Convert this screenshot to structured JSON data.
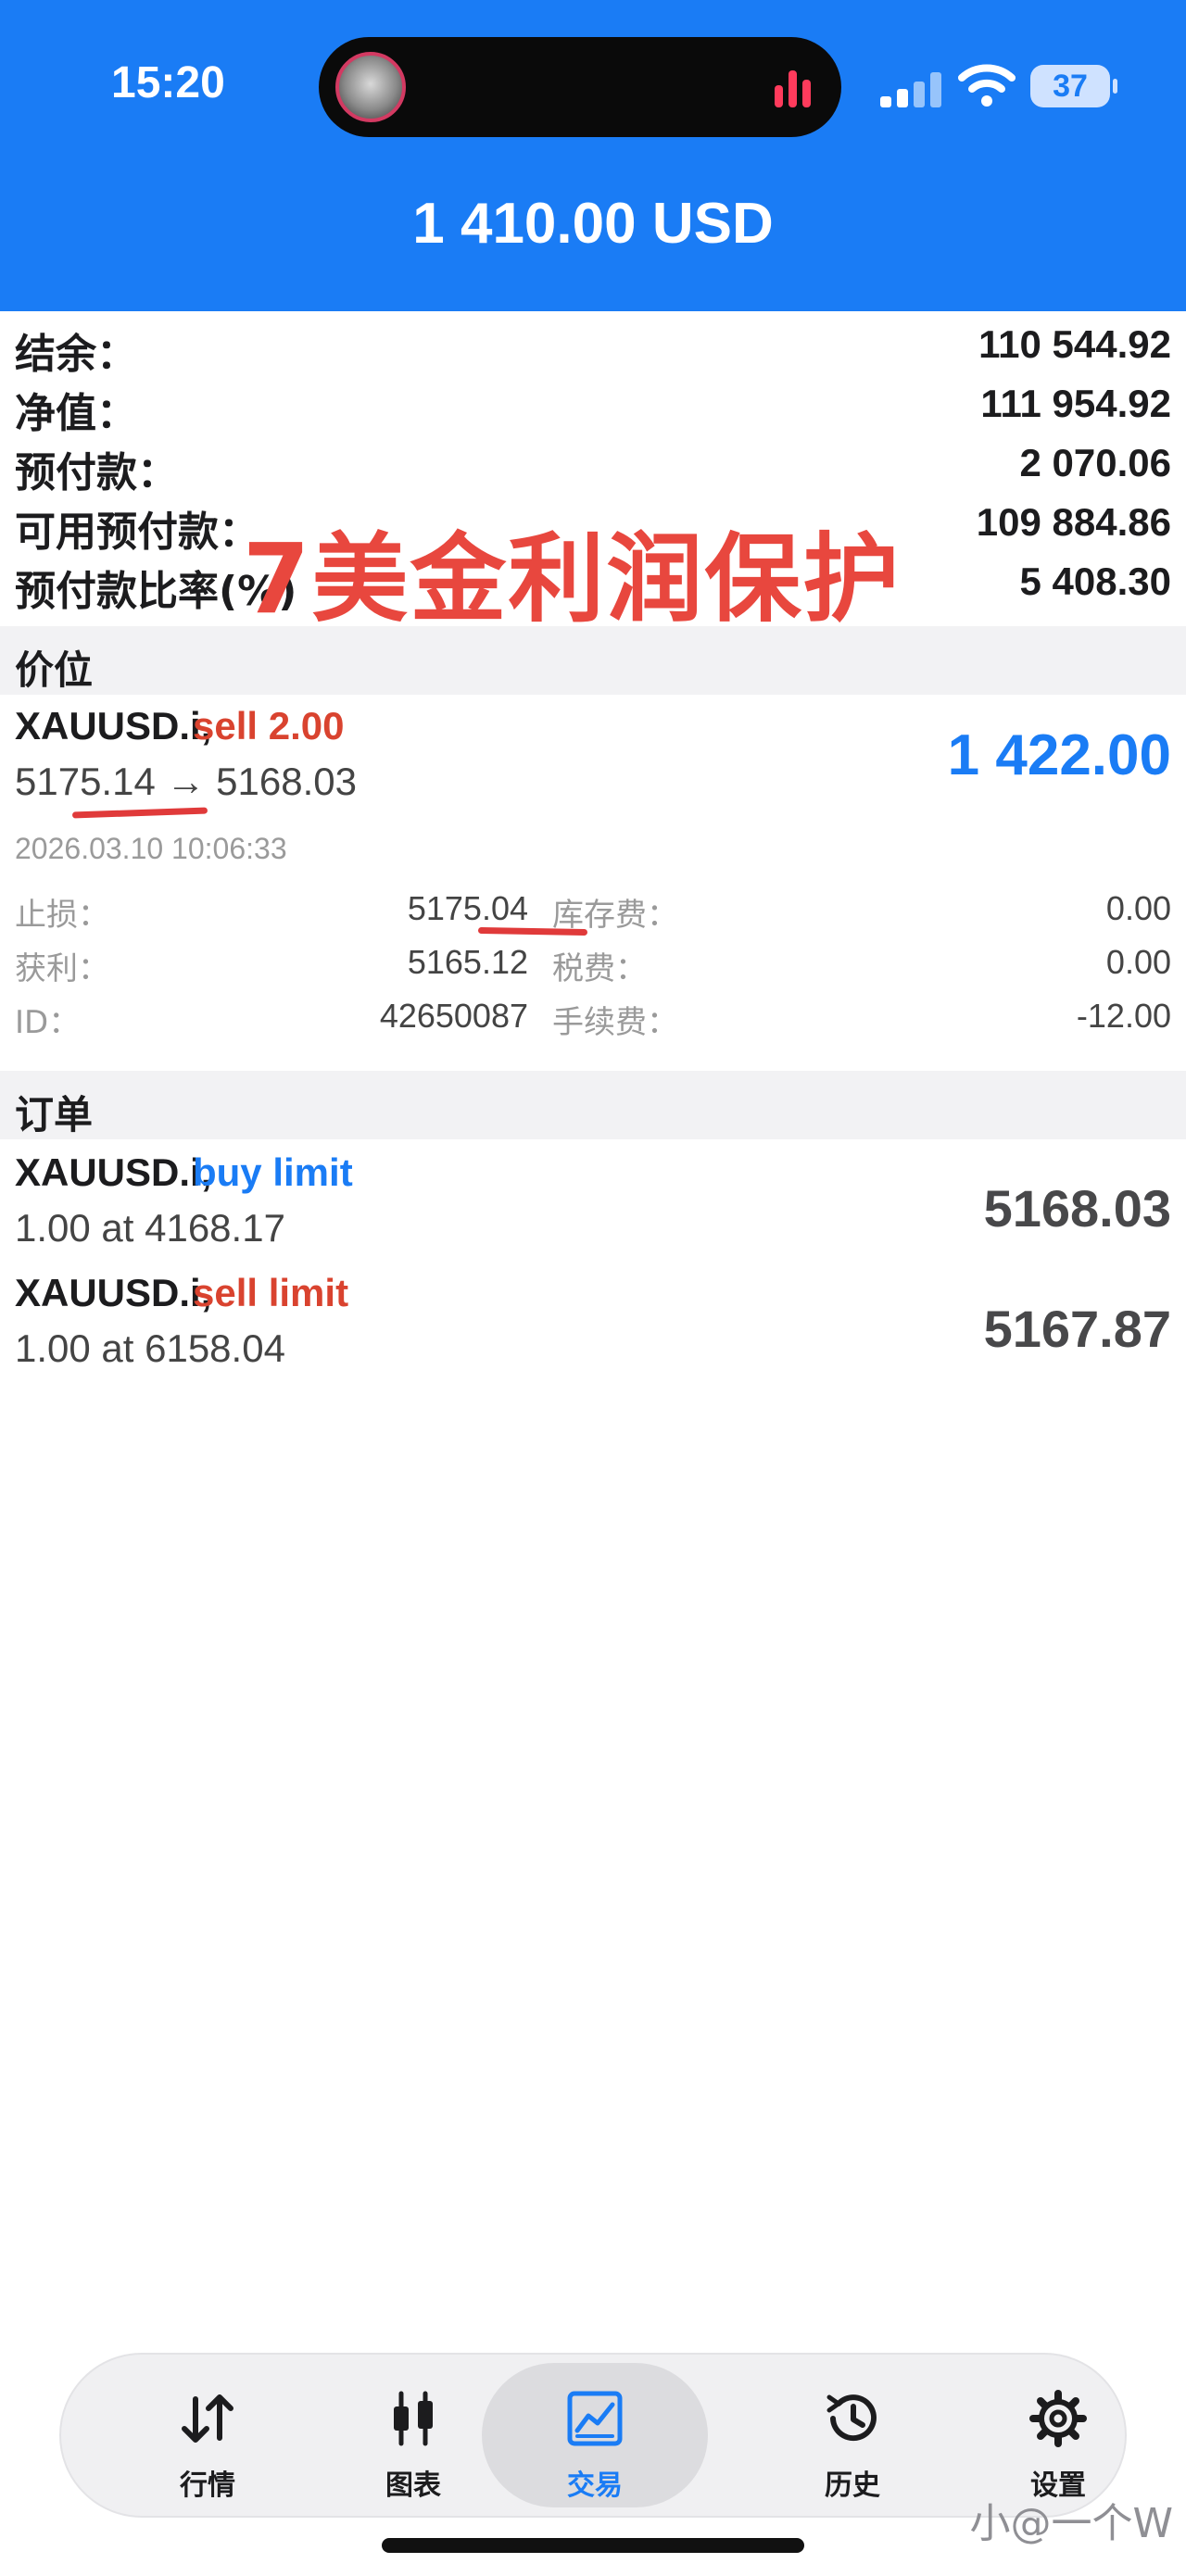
{
  "status_bar": {
    "time": "15:20",
    "battery": "37"
  },
  "header": {
    "balance_total": "1 410.00 USD"
  },
  "summary": [
    {
      "label": "结余：",
      "value": "110 544.92"
    },
    {
      "label": "净值：",
      "value": "111 954.92"
    },
    {
      "label": "预付款：",
      "value": "2 070.06"
    },
    {
      "label": "可用预付款：",
      "value": "109 884.86"
    },
    {
      "label": "预付款比率(%)",
      "value": "5 408.30"
    }
  ],
  "overlay_annotation": "7美金利润保护",
  "sections": {
    "positions": "价位",
    "orders": "订单"
  },
  "position": {
    "symbol": "XAUUSD.i,",
    "side": "sell 2.00",
    "open_price": "5175.14",
    "arrow": "→",
    "current_price": "5168.03",
    "profit": "1 422.00",
    "time": "2026.03.10 10:06:33",
    "details": [
      {
        "label1": "止损：",
        "value1": "5175.04",
        "label2": "库存费：",
        "value2": "0.00"
      },
      {
        "label1": "获利：",
        "value1": "5165.12",
        "label2": "税费：",
        "value2": "0.00"
      },
      {
        "label1": "ID：",
        "value1": "42650087",
        "label2": "手续费：",
        "value2": "-12.00"
      }
    ]
  },
  "orders": [
    {
      "symbol": "XAUUSD.i,",
      "type": "buy limit",
      "type_color": "#1a7cf5",
      "detail": "1.00 at 4168.17",
      "price": "5168.03"
    },
    {
      "symbol": "XAUUSD.i,",
      "type": "sell limit",
      "type_color": "#d9432f",
      "detail": "1.00 at 6158.04",
      "price": "5167.87"
    }
  ],
  "tabbar": [
    {
      "label": "行情",
      "icon": "arrows-updown-icon",
      "active": false
    },
    {
      "label": "图表",
      "icon": "candlestick-icon",
      "active": false
    },
    {
      "label": "交易",
      "icon": "trade-chart-icon",
      "active": true
    },
    {
      "label": "历史",
      "icon": "history-icon",
      "active": false
    },
    {
      "label": "设置",
      "icon": "gear-icon",
      "active": false
    }
  ],
  "watermark": "小@一个W",
  "colors": {
    "header_blue": "#1a7cf5",
    "sell_red": "#d9432f",
    "profit_blue": "#1a7cf5",
    "annotation_red": "#e8473e"
  }
}
